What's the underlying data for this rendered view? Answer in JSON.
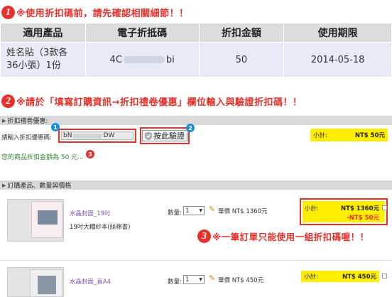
{
  "step1": {
    "num": "1",
    "text": "※使用折扣碼前，請先確認相關細節！！"
  },
  "table": {
    "headers": [
      "適用產品",
      "電子折抵碼",
      "折扣金額",
      "使用期限"
    ],
    "row": {
      "product_line1": "姓名貼（3款各",
      "product_line2": "36小張）1份",
      "code_start": "4C",
      "code_end": "bi",
      "amount": "50",
      "expiry": "2014-05-18"
    }
  },
  "step2": {
    "num": "2",
    "text": "※請於「填寫訂購資訊→折扣禮卷優惠」欄位輸入與驗證折扣碼！！"
  },
  "discount_section": {
    "header": "折扣禮卷優惠:",
    "input_label": "請輸入折扣優惠碼:",
    "input_value_start": "bN",
    "input_value_end": "DW",
    "verify_label": "按此驗證",
    "subtotal_label": "小計:",
    "subtotal_value": "NT$ 50元",
    "result_text": "您的商品折扣金額為 50 元...",
    "marker1": "1",
    "marker2": "2",
    "marker3": "3"
  },
  "order_section": {
    "header": "訂購產品、數量與價格",
    "products": [
      {
        "name": "水晶封面_19吋",
        "desc": "19吋大糟紗本(絲棉書)",
        "qty_label": "數量:",
        "qty": "1",
        "price": "單價 NT$ 1360元",
        "subtotal_label": "小計:",
        "subtotal": "NT$ 1360元",
        "discount": "-NT$ 50元"
      },
      {
        "name": "水晶封面_直A4",
        "qty_label": "數量:",
        "qty": "1",
        "price": "單價 NT$ 450元",
        "subtotal_label": "小計:",
        "subtotal": "NT$ 450元"
      }
    ]
  },
  "step3": {
    "num": "3",
    "text": "※一筆訂單只能使用一組折扣碼喔！！"
  }
}
